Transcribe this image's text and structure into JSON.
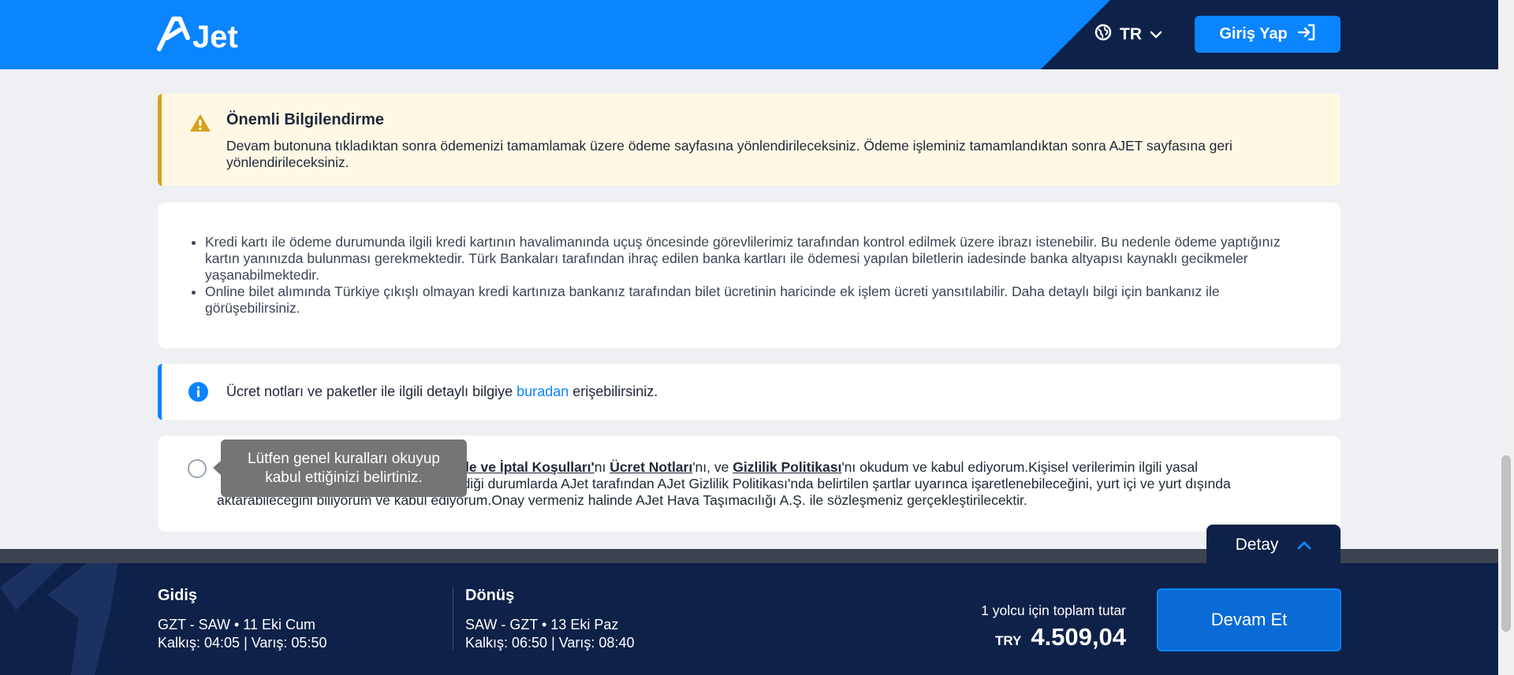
{
  "header": {
    "logo_text": "AJet",
    "language": "TR",
    "login_label": "Giriş Yap"
  },
  "warning": {
    "title": "Önemli Bilgilendirme",
    "text": "Devam butonuna tıkladıktan sonra ödemenizi tamamlamak üzere ödeme sayfasına yönlendirileceksiniz. Ödeme işleminiz tamamlandıktan sonra AJET sayfasına geri yönlendirileceksiniz."
  },
  "bullets": [
    "Kredi kartı ile ödeme durumunda ilgili kredi kartının havalimanında uçuş öncesinde görevlilerimiz tarafından kontrol edilmek üzere ibrazı istenebilir. Bu nedenle ödeme yaptığınız kartın yanınızda bulunması gerekmektedir. Türk Bankaları tarafından ihraç edilen banka kartları ile ödemesi yapılan biletlerin iadesinde banka altyapısı kaynaklı gecikmeler yaşanabilmektedir.",
    "Online bilet alımında Türkiye çıkışlı olmayan kredi kartınıza bankanız tarafından bilet ücretinin haricinde ek işlem ücreti yansıtılabilir. Daha detaylı bilgi için bankanız ile görüşebilirsiniz."
  ],
  "info": {
    "text_before": "Ücret notları ve paketler ile ilgili detaylı bilgiye ",
    "link": "buradan",
    "text_after": " erişebilirsiniz."
  },
  "consent": {
    "prefix": "G",
    "link_refund": "İade ve İptal Koşulları'",
    "suffix_refund": "nı ",
    "link_fare": "Ücret Notları",
    "suffix_fare": "'nı, ve ",
    "link_privacy": "Gizlilik Politikası",
    "line1_rest": "'nı okudum ve kabul ediyorum.Kişisel verilerimin ilgili yasal",
    "line2": "tirdiği durumlarda AJet tarafından AJet Gizlilik Politikası'nda belirtilen şartlar uyarınca işaretlenebileceğini, yurt içi ve yurt dışında",
    "line3": "aktarabileceğini biliyorum ve kabul ediyorum.Onay vermeniz halinde AJet Hava Taşımacılığı A.Ş. ile sözleşmeniz gerçekleştirilecektir."
  },
  "tooltip": {
    "line1": "Lütfen genel kuralları okuyup",
    "line2": "kabul ettiğinizi belirtiniz."
  },
  "detail_tab": {
    "label": "Detay"
  },
  "footer": {
    "outbound": {
      "title": "Gidiş",
      "route": "GZT - SAW • 11 Eki Cum",
      "times": "Kalkış: 04:05 | Varış: 05:50"
    },
    "return": {
      "title": "Dönüş",
      "route": "SAW - GZT • 13 Eki Paz",
      "times": "Kalkış: 06:50 | Varış: 08:40"
    },
    "total_label": "1 yolcu için toplam tutar",
    "currency": "TRY",
    "amount": "4.509,04",
    "continue_label": "Devam Et"
  },
  "colors": {
    "brand_blue": "#0a84ff",
    "navy": "#0e2148",
    "warning_bg": "#fff8e5",
    "warning_accent": "#d6a21e"
  }
}
